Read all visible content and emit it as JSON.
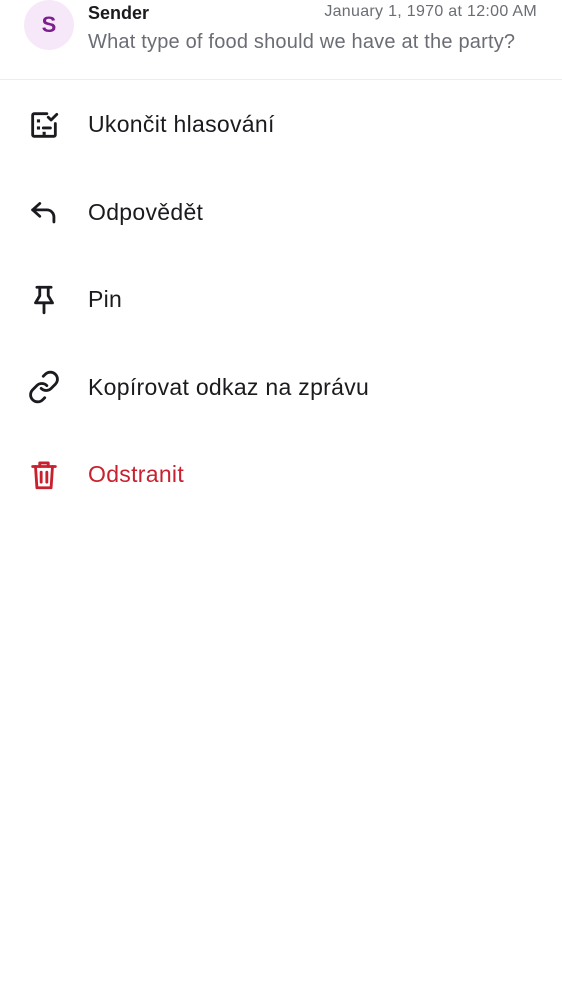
{
  "message": {
    "avatar_initial": "S",
    "sender": "Sender",
    "timestamp": "January 1, 1970 at 12:00 AM",
    "preview": "What type of food should we have at the party?"
  },
  "menu": {
    "items": [
      {
        "label": "Ukončit hlasování",
        "icon": "poll-check-icon"
      },
      {
        "label": "Odpovědět",
        "icon": "reply-icon"
      },
      {
        "label": "Pin",
        "icon": "pin-icon"
      },
      {
        "label": "Kopírovat odkaz na zprávu",
        "icon": "link-icon"
      },
      {
        "label": "Odstranit",
        "icon": "trash-icon"
      }
    ]
  },
  "colors": {
    "avatar_bg": "#f7e8f9",
    "avatar_fg": "#7a1f8c",
    "text_primary": "#1b1b1f",
    "text_secondary": "#6b6d74",
    "danger": "#c8202e"
  }
}
